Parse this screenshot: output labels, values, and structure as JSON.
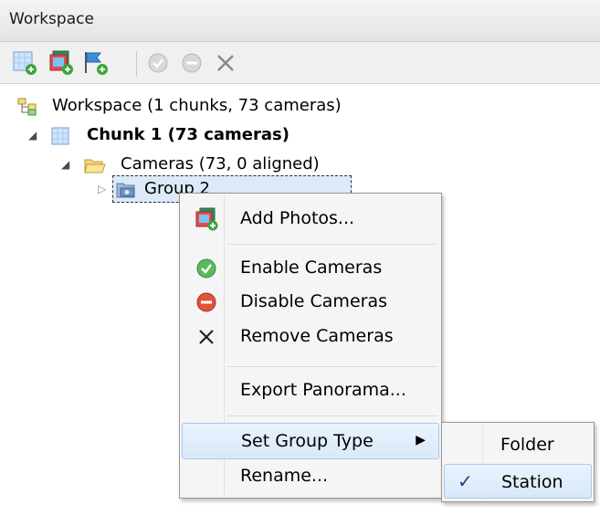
{
  "panel": {
    "title": "Workspace"
  },
  "toolbar": {
    "buttons": [
      {
        "icon": "add-chunk-icon",
        "tooltip": ""
      },
      {
        "icon": "add-photos-icon",
        "tooltip": ""
      },
      {
        "icon": "add-camera-group-icon",
        "tooltip": ""
      },
      {
        "icon": "enable-cameras-icon",
        "tooltip": ""
      },
      {
        "icon": "disable-cameras-icon",
        "tooltip": ""
      },
      {
        "icon": "remove-cameras-icon",
        "tooltip": ""
      }
    ]
  },
  "tree": {
    "workspace": "Workspace (1 chunks, 73 cameras)",
    "chunk": "Chunk 1 (73 cameras)",
    "cameras": "Cameras (73, 0 aligned)",
    "group": "Group 2"
  },
  "context_menu": {
    "add_photos": "Add Photos...",
    "enable_cameras": "Enable Cameras",
    "disable_cameras": "Disable Cameras",
    "remove_cameras": "Remove Cameras",
    "export_panorama": "Export Panorama...",
    "set_group_type": "Set Group Type",
    "rename": "Rename..."
  },
  "submenu": {
    "folder": "Folder",
    "station": "Station",
    "checked": "✓"
  },
  "colors": {
    "highlight": "#d9e8f9",
    "enable_green": "#4fb04a",
    "disable_red": "#e0533a"
  }
}
